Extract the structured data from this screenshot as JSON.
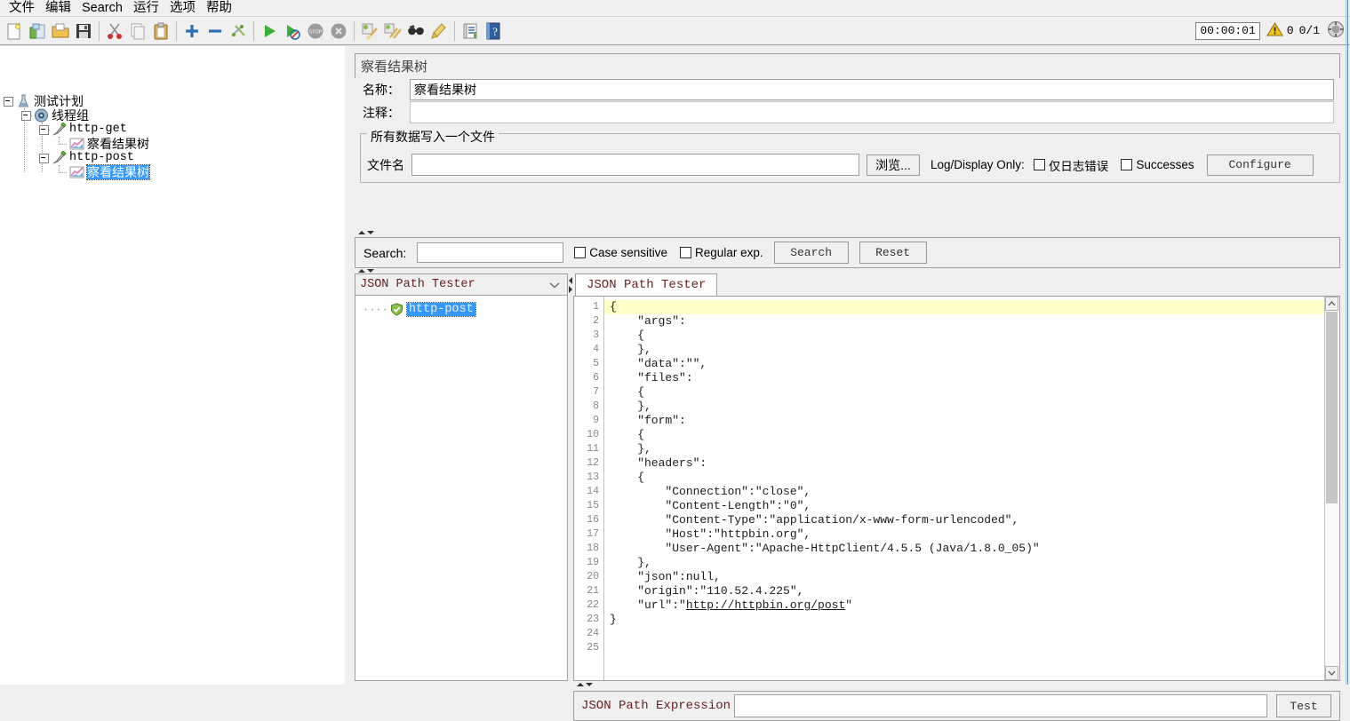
{
  "menu": {
    "items": [
      {
        "label": "文件",
        "name": "menu-file"
      },
      {
        "label": "编辑",
        "name": "menu-edit"
      },
      {
        "label": "Search",
        "name": "menu-search"
      },
      {
        "label": "运行",
        "name": "menu-run"
      },
      {
        "label": "选项",
        "name": "menu-options"
      },
      {
        "label": "帮助",
        "name": "menu-help"
      }
    ]
  },
  "toolbar": {
    "icons": [
      {
        "name": "new-icon"
      },
      {
        "name": "templates-icon"
      },
      {
        "name": "open-icon"
      },
      {
        "name": "save-icon"
      },
      {
        "name": "cut-icon"
      },
      {
        "name": "copy-icon"
      },
      {
        "name": "paste-icon"
      },
      {
        "name": "expand-all-icon"
      },
      {
        "name": "collapse-all-icon"
      },
      {
        "name": "toggle-icon"
      },
      {
        "name": "start-icon"
      },
      {
        "name": "start-no-pauses-icon"
      },
      {
        "name": "stop-icon"
      },
      {
        "name": "shutdown-icon"
      },
      {
        "name": "clear-icon"
      },
      {
        "name": "clear-all-icon"
      },
      {
        "name": "search-icon"
      },
      {
        "name": "reset-search-icon"
      },
      {
        "name": "function-helper-icon"
      },
      {
        "name": "help-icon"
      }
    ],
    "timer": "00:00:01",
    "warnings": "0",
    "threads": "0/1",
    "reset_label": "reset-icon"
  },
  "tree": {
    "nodes": [
      {
        "label": "测试计划",
        "icon": "test-plan-icon",
        "depth": 0,
        "selected": false
      },
      {
        "label": "线程组",
        "icon": "thread-group-icon",
        "depth": 1,
        "selected": false
      },
      {
        "label": "http-get",
        "icon": "http-sampler-icon",
        "depth": 2,
        "selected": false
      },
      {
        "label": "察看结果树",
        "icon": "view-results-tree-icon",
        "depth": 3,
        "selected": false
      },
      {
        "label": "http-post",
        "icon": "http-sampler-icon",
        "depth": 2,
        "selected": false
      },
      {
        "label": "察看结果树",
        "icon": "view-results-tree-icon",
        "depth": 3,
        "selected": true
      }
    ]
  },
  "panel": {
    "title": "察看结果树",
    "name_label": "名称：",
    "name_value": "察看结果树",
    "comment_label": "注释：",
    "comment_value": "",
    "filegroup_title": "所有数据写入一个文件",
    "filename_label": "文件名",
    "filename_value": "",
    "browse_label": "浏览...",
    "logdisplay_label": "Log/Display Only:",
    "errors_only_label": "仅日志错误",
    "successes_label": "Successes",
    "configure_label": "Configure"
  },
  "search": {
    "label": "Search:",
    "value": "",
    "case_sensitive_label": "Case sensitive",
    "regular_exp_label": "Regular exp.",
    "search_button": "Search",
    "reset_button": "Reset"
  },
  "results": {
    "renderer_selected": "JSON Path Tester",
    "item_label": "http-post",
    "item_status": "success-icon",
    "tab_label": "JSON Path Tester"
  },
  "editor": {
    "highlight_line": 1,
    "line_numbers": [
      "1",
      "2",
      "3",
      "4",
      "5",
      "6",
      "7",
      "8",
      "9",
      "10",
      "11",
      "12",
      "13",
      "14",
      "15",
      "16",
      "17",
      "18",
      "19",
      "20",
      "21",
      "22",
      "23",
      "24",
      "25"
    ],
    "lines": [
      "{",
      "    \"args\":",
      "    {",
      "    },",
      "    \"data\":\"\",",
      "    \"files\":",
      "    {",
      "    },",
      "    \"form\":",
      "    {",
      "    },",
      "    \"headers\":",
      "    {",
      "        \"Connection\":\"close\",",
      "        \"Content-Length\":\"0\",",
      "        \"Content-Type\":\"application/x-www-form-urlencoded\",",
      "        \"Host\":\"httpbin.org\",",
      "        \"User-Agent\":\"Apache-HttpClient/4.5.5 (Java/1.8.0_05)\"",
      "    },",
      "    \"json\":null,",
      "    \"origin\":\"110.52.4.225\",",
      "    \"url\":\"http://httpbin.org/post\"",
      "}",
      "",
      ""
    ],
    "link_line_index": 21,
    "link_prefix": "    \"url\":\"",
    "link_text": "http://httpbin.org/post",
    "link_suffix": "\""
  },
  "expression": {
    "label": "JSON Path Expression",
    "value": "",
    "test_button": "Test"
  },
  "colors": {
    "selection_blue": "#3399ff",
    "highlight_yellow": "#ffffc8",
    "tab_text": "#6b2020",
    "edge_blue": "#5b8db8"
  }
}
